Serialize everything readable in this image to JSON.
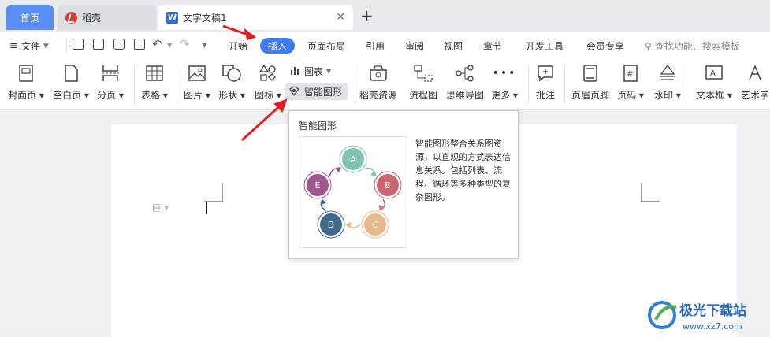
{
  "tabs": {
    "home": "首页",
    "daoke": "稻壳",
    "doc": "文字文稿1",
    "doc_logo": "W"
  },
  "menu": {
    "file": "文件",
    "items": [
      "开始",
      "插入",
      "页面布局",
      "引用",
      "审阅",
      "视图",
      "章节",
      "开发工具",
      "会员专享"
    ],
    "search": "查找功能、搜索模板"
  },
  "ribbon": {
    "cover": "封面页",
    "blank": "空白页",
    "pagebreak": "分页",
    "table": "表格",
    "picture": "图片",
    "shape": "形状",
    "icon": "图标",
    "chart": "图表",
    "smartart": "智能图形",
    "daoke_res": "稻壳资源",
    "flowchart": "流程图",
    "mindmap": "思维导图",
    "more": "更多",
    "comment": "批注",
    "header_footer": "页眉页脚",
    "page_number": "页码",
    "watermark": "水印",
    "textbox": "文本框",
    "wordart": "艺术字"
  },
  "popup": {
    "title": "智能图形",
    "description": "智能图形整合关系图资源，以直观的方式表达信息关系。包括列表、流程、循环等多种类型的复杂图形。",
    "nodes": [
      "A",
      "B",
      "C",
      "D",
      "E"
    ]
  },
  "watermark": {
    "name": "极光下载站",
    "url": "www.xz7.com"
  },
  "colors": {
    "accent": "#3d7cf2",
    "home_tab": "#5b8ef2",
    "arrow": "#e02020",
    "node_a": "#7fc4ae",
    "node_b": "#c9666f",
    "node_c": "#e8b88a",
    "node_d": "#3f6a8c",
    "node_e": "#a0568f"
  }
}
